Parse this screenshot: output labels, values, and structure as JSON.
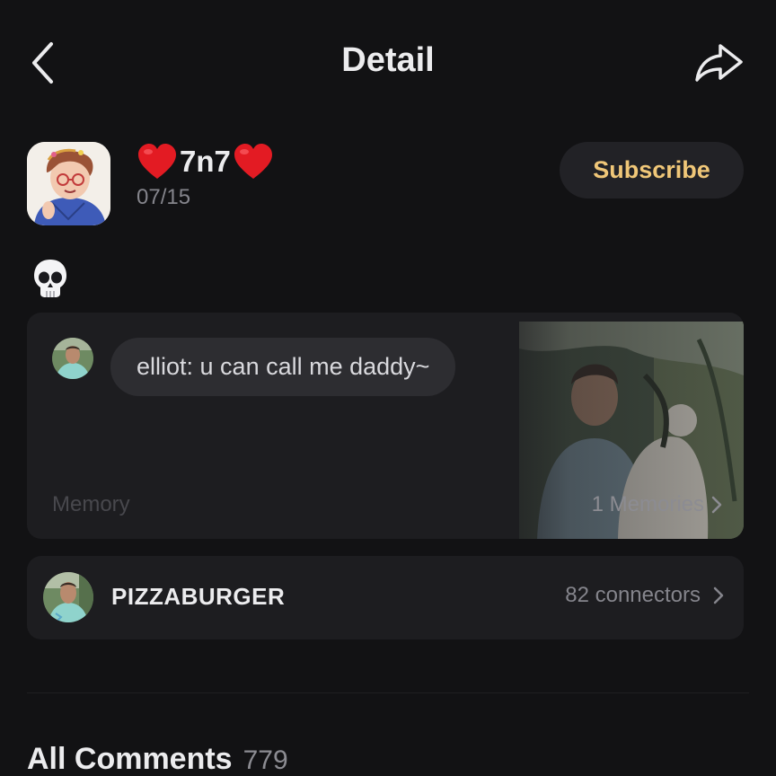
{
  "header": {
    "title": "Detail",
    "back_icon": "chevron-left-icon",
    "share_icon": "share-arrow-icon"
  },
  "post": {
    "author_name": "7n7",
    "author_decoration_icon": "red-heart-icon",
    "date": "07/15",
    "subscribe_label": "Subscribe",
    "body_emoji": "skull-emoji",
    "accent_color": "#f0c778"
  },
  "memory_card": {
    "message": "elliot: u can call me daddy~",
    "label": "Memory",
    "count_label": "1 Memories"
  },
  "group": {
    "name": "PIZZABURGER",
    "connectors": "82 connectors"
  },
  "comments": {
    "title": "All Comments",
    "count": "779"
  }
}
